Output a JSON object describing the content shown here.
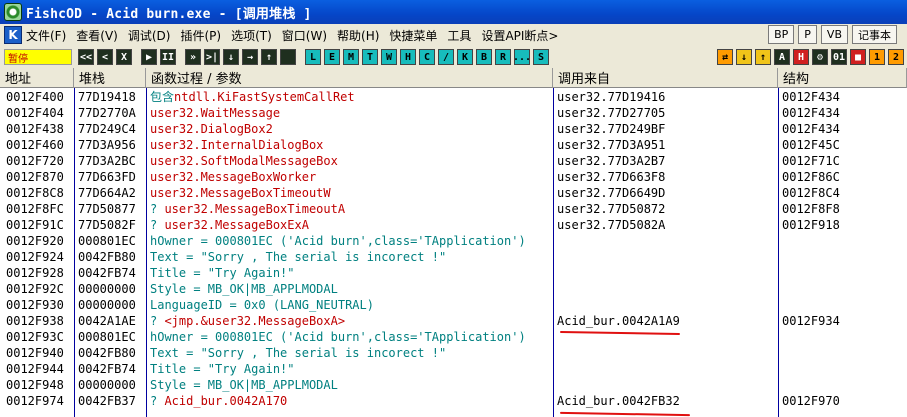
{
  "window": {
    "title": "FishcOD - Acid burn.exe - [调用堆栈 ]"
  },
  "menu": {
    "items": [
      "文件(F)",
      "查看(V)",
      "调试(D)",
      "插件(P)",
      "选项(T)",
      "窗口(W)",
      "帮助(H)",
      "快捷菜单",
      "工具",
      "设置API断点>"
    ],
    "right_buttons": [
      "BP",
      "P",
      "VB",
      "记事本"
    ]
  },
  "toolbar": {
    "status": "暂停",
    "buttons": [
      "<<",
      "<",
      "X",
      "▶",
      "II",
      "»",
      ">|",
      "↓",
      "→",
      "↑",
      "",
      "L",
      "E",
      "M",
      "T",
      "W",
      "H",
      "C",
      "/",
      "K",
      "B",
      "R",
      "...",
      "S"
    ]
  },
  "table": {
    "headers": [
      "地址",
      "堆栈",
      "函数过程 / 参数",
      "调用来自",
      "结构"
    ],
    "rows": [
      {
        "addr": "0012F400",
        "stack": "77D19418",
        "prefix": "包含",
        "proc": "ntdll.KiFastSystemCallRet",
        "proc_color": "red",
        "caller": "user32.77D19416",
        "frame": "0012F434"
      },
      {
        "addr": "0012F404",
        "stack": "77D2770A",
        "prefix": "",
        "proc": "user32.WaitMessage",
        "proc_color": "red",
        "caller": "user32.77D27705",
        "frame": "0012F434"
      },
      {
        "addr": "0012F438",
        "stack": "77D249C4",
        "prefix": "",
        "proc": "user32.DialogBox2",
        "proc_color": "red",
        "caller": "user32.77D249BF",
        "frame": "0012F434"
      },
      {
        "addr": "0012F460",
        "stack": "77D3A956",
        "prefix": "",
        "proc": "user32.InternalDialogBox",
        "proc_color": "red",
        "caller": "user32.77D3A951",
        "frame": "0012F45C"
      },
      {
        "addr": "0012F720",
        "stack": "77D3A2BC",
        "prefix": "",
        "proc": "user32.SoftModalMessageBox",
        "proc_color": "red",
        "caller": "user32.77D3A2B7",
        "frame": "0012F71C"
      },
      {
        "addr": "0012F870",
        "stack": "77D663FD",
        "prefix": "",
        "proc": "user32.MessageBoxWorker",
        "proc_color": "red",
        "caller": "user32.77D663F8",
        "frame": "0012F86C"
      },
      {
        "addr": "0012F8C8",
        "stack": "77D664A2",
        "prefix": "",
        "proc": "user32.MessageBoxTimeoutW",
        "proc_color": "red",
        "caller": "user32.77D6649D",
        "frame": "0012F8C4"
      },
      {
        "addr": "0012F8FC",
        "stack": "77D50877",
        "prefix": "? ",
        "proc": "user32.MessageBoxTimeoutA",
        "proc_color": "red",
        "caller": "user32.77D50872",
        "frame": "0012F8F8"
      },
      {
        "addr": "0012F91C",
        "stack": "77D5082F",
        "prefix": "? ",
        "proc": "user32.MessageBoxExA",
        "proc_color": "red",
        "caller": "user32.77D5082A",
        "frame": "0012F918"
      },
      {
        "addr": "0012F920",
        "stack": "000801EC",
        "prefix": "",
        "proc": "  hOwner = 000801EC ('Acid burn',class='TApplication')",
        "proc_color": "teal",
        "caller": "",
        "frame": ""
      },
      {
        "addr": "0012F924",
        "stack": "0042FB80",
        "prefix": "",
        "proc": "  Text = \"Sorry , The serial is incorect !\"",
        "proc_color": "teal",
        "caller": "",
        "frame": ""
      },
      {
        "addr": "0012F928",
        "stack": "0042FB74",
        "prefix": "",
        "proc": "  Title = \"Try Again!\"",
        "proc_color": "teal",
        "caller": "",
        "frame": ""
      },
      {
        "addr": "0012F92C",
        "stack": "00000000",
        "prefix": "",
        "proc": "  Style = MB_OK|MB_APPLMODAL",
        "proc_color": "teal",
        "caller": "",
        "frame": ""
      },
      {
        "addr": "0012F930",
        "stack": "00000000",
        "prefix": "",
        "proc": "  LanguageID = 0x0 (LANG_NEUTRAL)",
        "proc_color": "teal",
        "caller": "",
        "frame": ""
      },
      {
        "addr": "0012F938",
        "stack": "0042A1AE",
        "prefix": "? ",
        "proc": "<jmp.&user32.MessageBoxA>",
        "proc_color": "red",
        "caller": "Acid_bur.0042A1A9",
        "frame": "0012F934"
      },
      {
        "addr": "0012F93C",
        "stack": "000801EC",
        "prefix": "",
        "proc": "  hOwner = 000801EC ('Acid burn',class='TApplication')",
        "proc_color": "teal",
        "caller": "",
        "frame": ""
      },
      {
        "addr": "0012F940",
        "stack": "0042FB80",
        "prefix": "",
        "proc": "  Text = \"Sorry , The serial is incorect !\"",
        "proc_color": "teal",
        "caller": "",
        "frame": ""
      },
      {
        "addr": "0012F944",
        "stack": "0042FB74",
        "prefix": "",
        "proc": "  Title = \"Try Again!\"",
        "proc_color": "teal",
        "caller": "",
        "frame": ""
      },
      {
        "addr": "0012F948",
        "stack": "00000000",
        "prefix": "",
        "proc": "  Style = MB_OK|MB_APPLMODAL",
        "proc_color": "teal",
        "caller": "",
        "frame": ""
      },
      {
        "addr": "0012F974",
        "stack": "0042FB37",
        "prefix": "? ",
        "proc": "Acid_bur.0042A170",
        "proc_color": "red",
        "caller": "Acid_bur.0042FB32",
        "frame": "0012F970"
      }
    ]
  },
  "annotations": {
    "underline_color": "#e01010"
  }
}
